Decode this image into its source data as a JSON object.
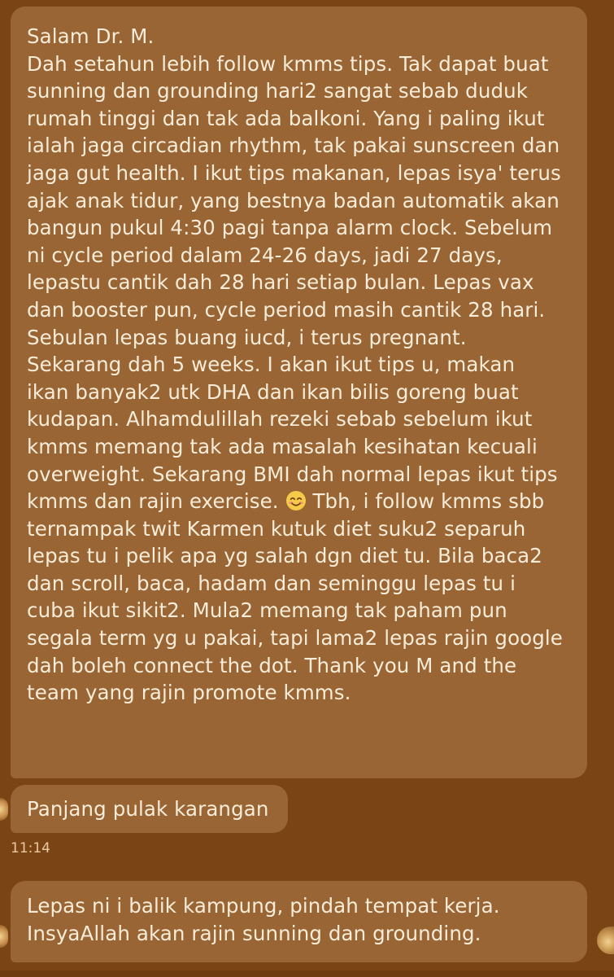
{
  "chat": {
    "message_1": {
      "lines": [
        "Salam Dr. M.",
        "Dah setahun lebih follow kmms tips. Tak dapat buat",
        "sunning dan grounding hari2 sangat sebab duduk",
        "rumah tinggi dan tak ada balkoni. Yang i paling ikut",
        "ialah jaga circadian rhythm, tak pakai sunscreen dan",
        "jaga gut health. I ikut tips makanan, lepas isya' terus",
        "ajak anak tidur, yang bestnya badan automatik akan",
        "bangun pukul 4:30 pagi tanpa alarm clock. Sebelum",
        "ni cycle period dalam 24-26 days, jadi 27 days,",
        "lepastu cantik dah 28 hari setiap bulan. Lepas vax",
        "dan booster pun, cycle period masih cantik 28 hari.",
        "Sebulan lepas buang iucd, i terus pregnant.",
        "Sekarang dah 5 weeks. I akan ikut tips u, makan",
        "ikan banyak2 utk DHA dan ikan bilis goreng buat",
        "kudapan. Alhamdulillah rezeki sebab sebelum ikut",
        "kmms memang tak ada masalah kesihatan kecuali",
        "overweight. Sekarang BMI dah normal lepas ikut tips",
        "kmms dan rajin exercise.",
        "ternampak twit Karmen kutuk diet suku2 separuh",
        "lepas tu i pelik apa yg salah dgn diet tu. Bila baca2",
        "dan scroll, baca, hadam dan seminggu lepas tu i",
        "cuba ikut sikit2. Mula2 memang tak paham pun",
        "segala term yg u pakai, tapi lama2 lepas rajin google",
        "dah boleh connect the dot. Thank you M and the",
        "team yang rajin promote kmms."
      ],
      "line_18_after_emoji": " Tbh, i follow kmms sbb"
    },
    "message_2": {
      "text": "Panjang pulak karangan"
    },
    "timestamp": "11:14",
    "message_3": {
      "lines": [
        "Lepas ni i balik kampung, pindah tempat kerja.",
        "InsyaAllah akan rajin sunning dan grounding."
      ]
    },
    "icons": {
      "emoji": "smiling-face-with-smiling-eyes-icon",
      "avatar": "avatar"
    },
    "colors": {
      "background": "#7a4414",
      "bubble": "#9a6534",
      "text": "#f7ecd8"
    }
  }
}
